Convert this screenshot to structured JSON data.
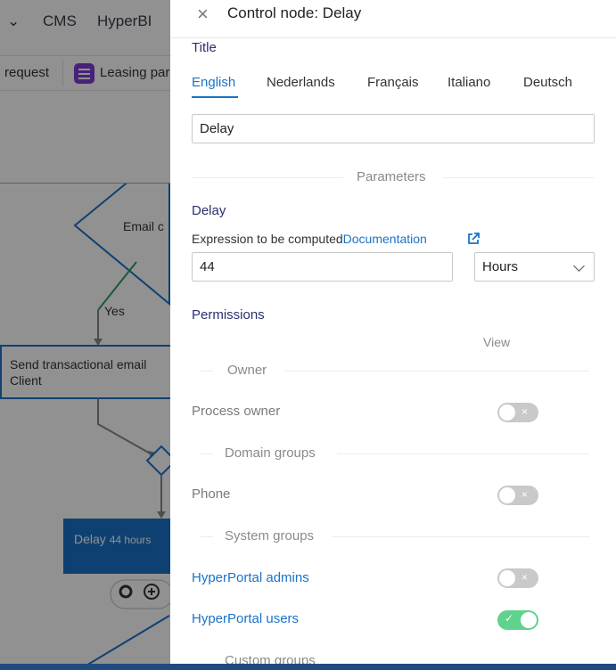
{
  "background": {
    "nav": [
      "CMS",
      "HyperBI"
    ],
    "tabs": [
      "request",
      "Leasing par"
    ],
    "diagram": {
      "email_node": "Email c",
      "yes_label": "Yes",
      "send_node_line1": "Send transactional email",
      "send_node_line2": "Client",
      "delay_node_label": "Delay",
      "delay_node_value": "44 hours"
    }
  },
  "panel": {
    "title": "Control node: Delay",
    "title_section": "Title",
    "languages": [
      "English",
      "Nederlands",
      "Français",
      "Italiano",
      "Deutsch"
    ],
    "active_language": "English",
    "title_value": "Delay",
    "parameters_label": "Parameters",
    "delay_label": "Delay",
    "expression_label": "Expression to be computed",
    "documentation_link": "Documentation",
    "delay_value": "44",
    "unit_value": "Hours",
    "permissions_label": "Permissions",
    "view_column": "View",
    "groups": [
      {
        "name": "Owner",
        "rows": [
          {
            "label": "Process owner",
            "on": false,
            "link": false
          }
        ]
      },
      {
        "name": "Domain groups",
        "rows": [
          {
            "label": "Phone",
            "on": false,
            "link": false
          }
        ]
      },
      {
        "name": "System groups",
        "rows": [
          {
            "label": "HyperPortal admins",
            "on": false,
            "link": true
          },
          {
            "label": "HyperPortal users",
            "on": true,
            "link": true
          }
        ]
      },
      {
        "name": "Custom groups",
        "rows": []
      }
    ]
  },
  "colors": {
    "accent": "#1a73c8",
    "toggle_on": "#5fd38d",
    "toggle_off": "#c9c9c9",
    "diagram_blue": "#1a73c8"
  }
}
